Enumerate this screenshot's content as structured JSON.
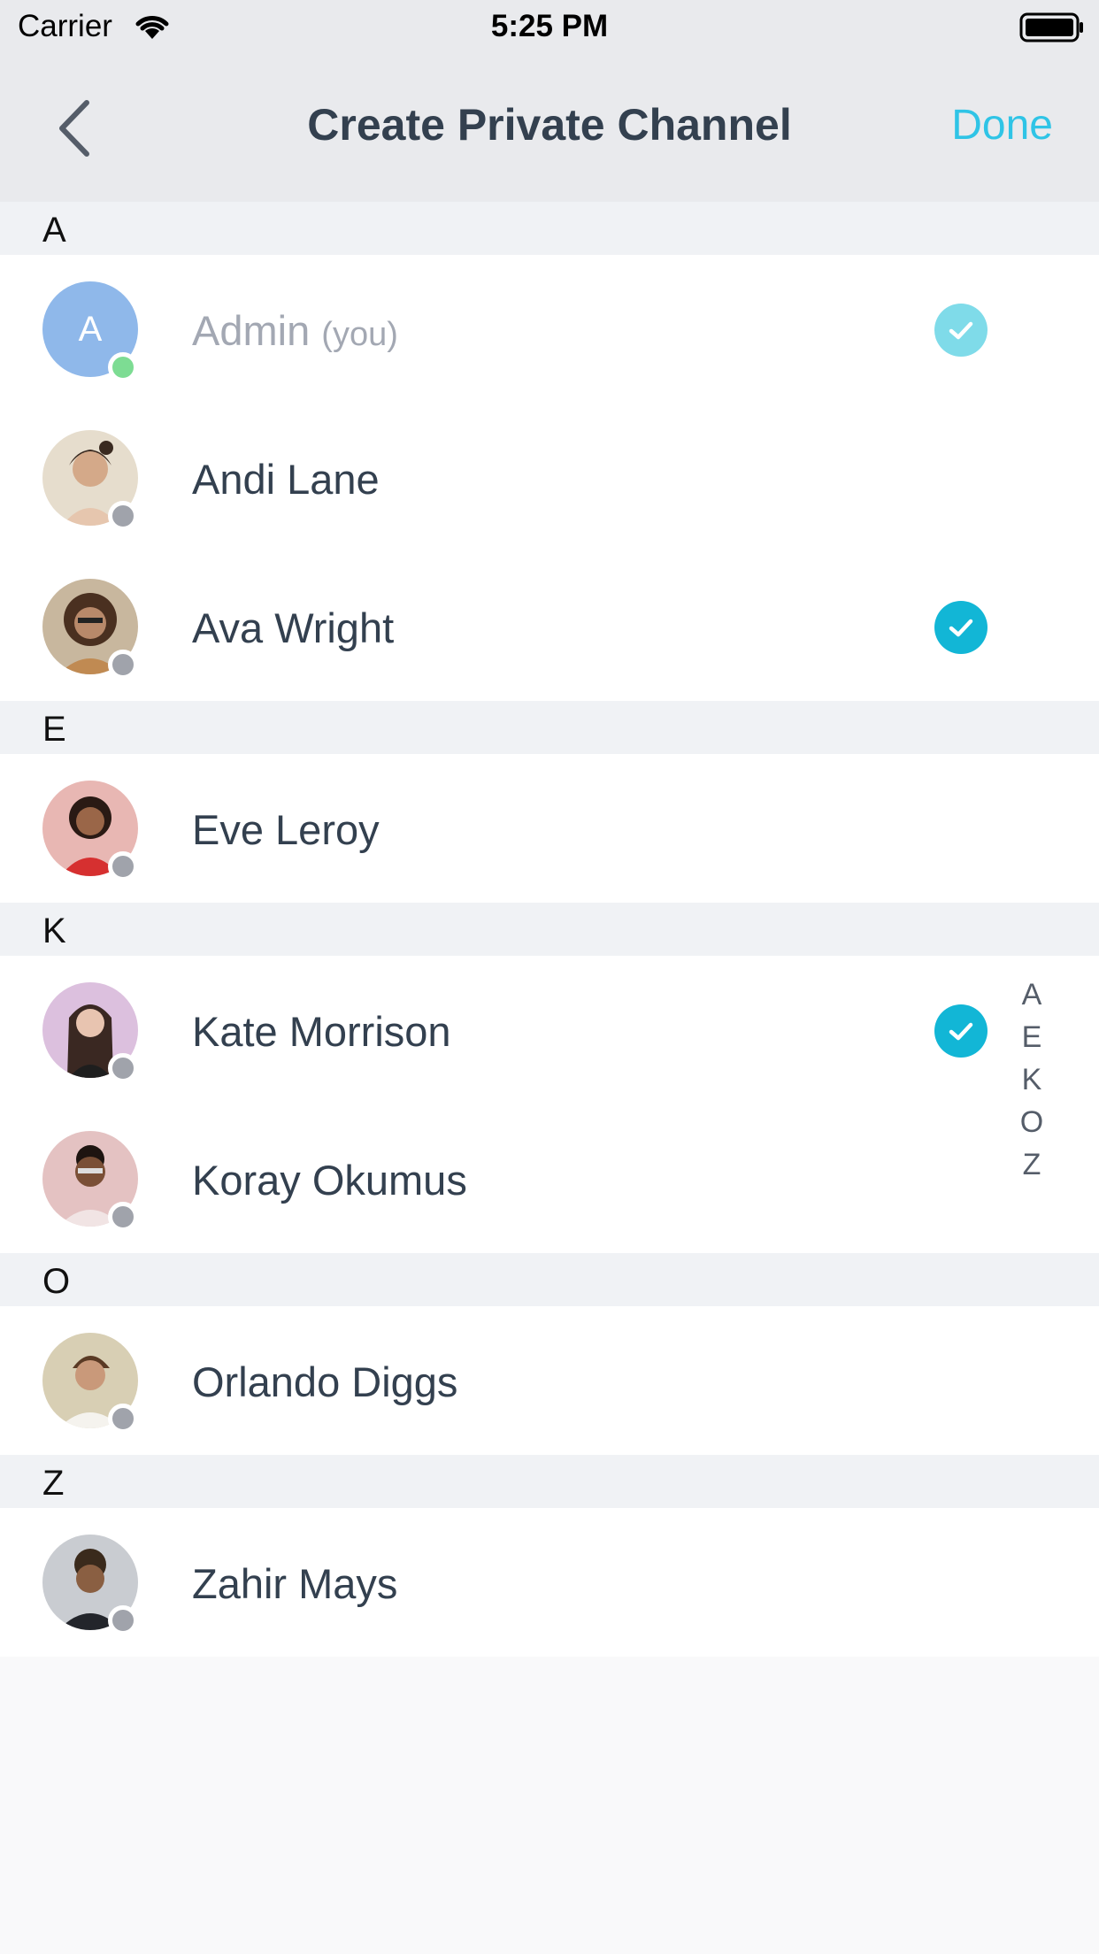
{
  "status_bar": {
    "carrier": "Carrier",
    "time": "5:25 PM"
  },
  "nav": {
    "title": "Create Private Channel",
    "done_label": "Done"
  },
  "sections": [
    {
      "letter": "A"
    },
    {
      "letter": "E"
    },
    {
      "letter": "K"
    },
    {
      "letter": "O"
    },
    {
      "letter": "Z"
    }
  ],
  "contacts": {
    "admin": {
      "initial": "A",
      "name": "Admin",
      "suffix": "(you)",
      "selected": true,
      "online": true
    },
    "andi": {
      "name": "Andi Lane",
      "selected": false
    },
    "ava": {
      "name": "Ava Wright",
      "selected": true
    },
    "eve": {
      "name": "Eve Leroy",
      "selected": false
    },
    "kate": {
      "name": "Kate Morrison",
      "selected": true
    },
    "koray": {
      "name": "Koray Okumus",
      "selected": false
    },
    "orlando": {
      "name": "Orlando Diggs",
      "selected": false
    },
    "zahir": {
      "name": "Zahir Mays",
      "selected": false
    }
  },
  "section_index": [
    "A",
    "E",
    "K",
    "O",
    "Z"
  ],
  "colors": {
    "accent": "#2fc4e6",
    "check": "#12b6d6",
    "online": "#7ddc93",
    "offline": "#a0a3ab"
  }
}
